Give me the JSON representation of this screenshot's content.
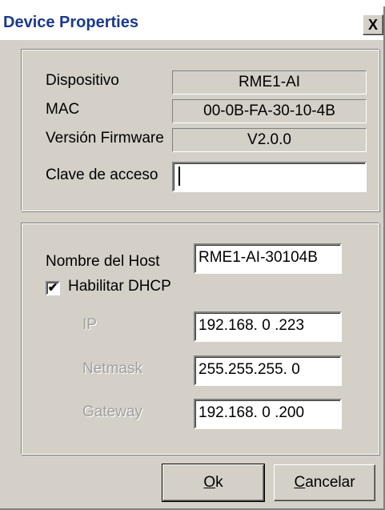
{
  "window": {
    "title": "Device Properties",
    "close_glyph": "X"
  },
  "device_info": {
    "device_label": "Dispositivo",
    "device_value": "RME1-AI",
    "mac_label": "MAC",
    "mac_value": "00-0B-FA-30-10-4B",
    "firmware_label": "Versión Firmware",
    "firmware_value": "V2.0.0",
    "password_label": "Clave de acceso",
    "password_value": ""
  },
  "network": {
    "hostname_label": "Nombre del Host",
    "hostname_value": "RME1-AI-30104B",
    "dhcp_label": "Habilitar DHCP",
    "dhcp_checked": true,
    "ip_label": "IP",
    "ip_value": "192.168.  0 .223",
    "netmask_label": "Netmask",
    "netmask_value": "255.255.255.  0",
    "gateway_label": "Gateway",
    "gateway_value": "192.168.  0 .200"
  },
  "buttons": {
    "ok_mnemonic": "O",
    "ok_rest": "k",
    "cancel_mnemonic": "C",
    "cancel_rest": "ancelar"
  },
  "colors": {
    "dialog_bg": "#d4d0c8",
    "title_text": "#1a3a8c",
    "disabled_text": "#a0a0a0"
  }
}
